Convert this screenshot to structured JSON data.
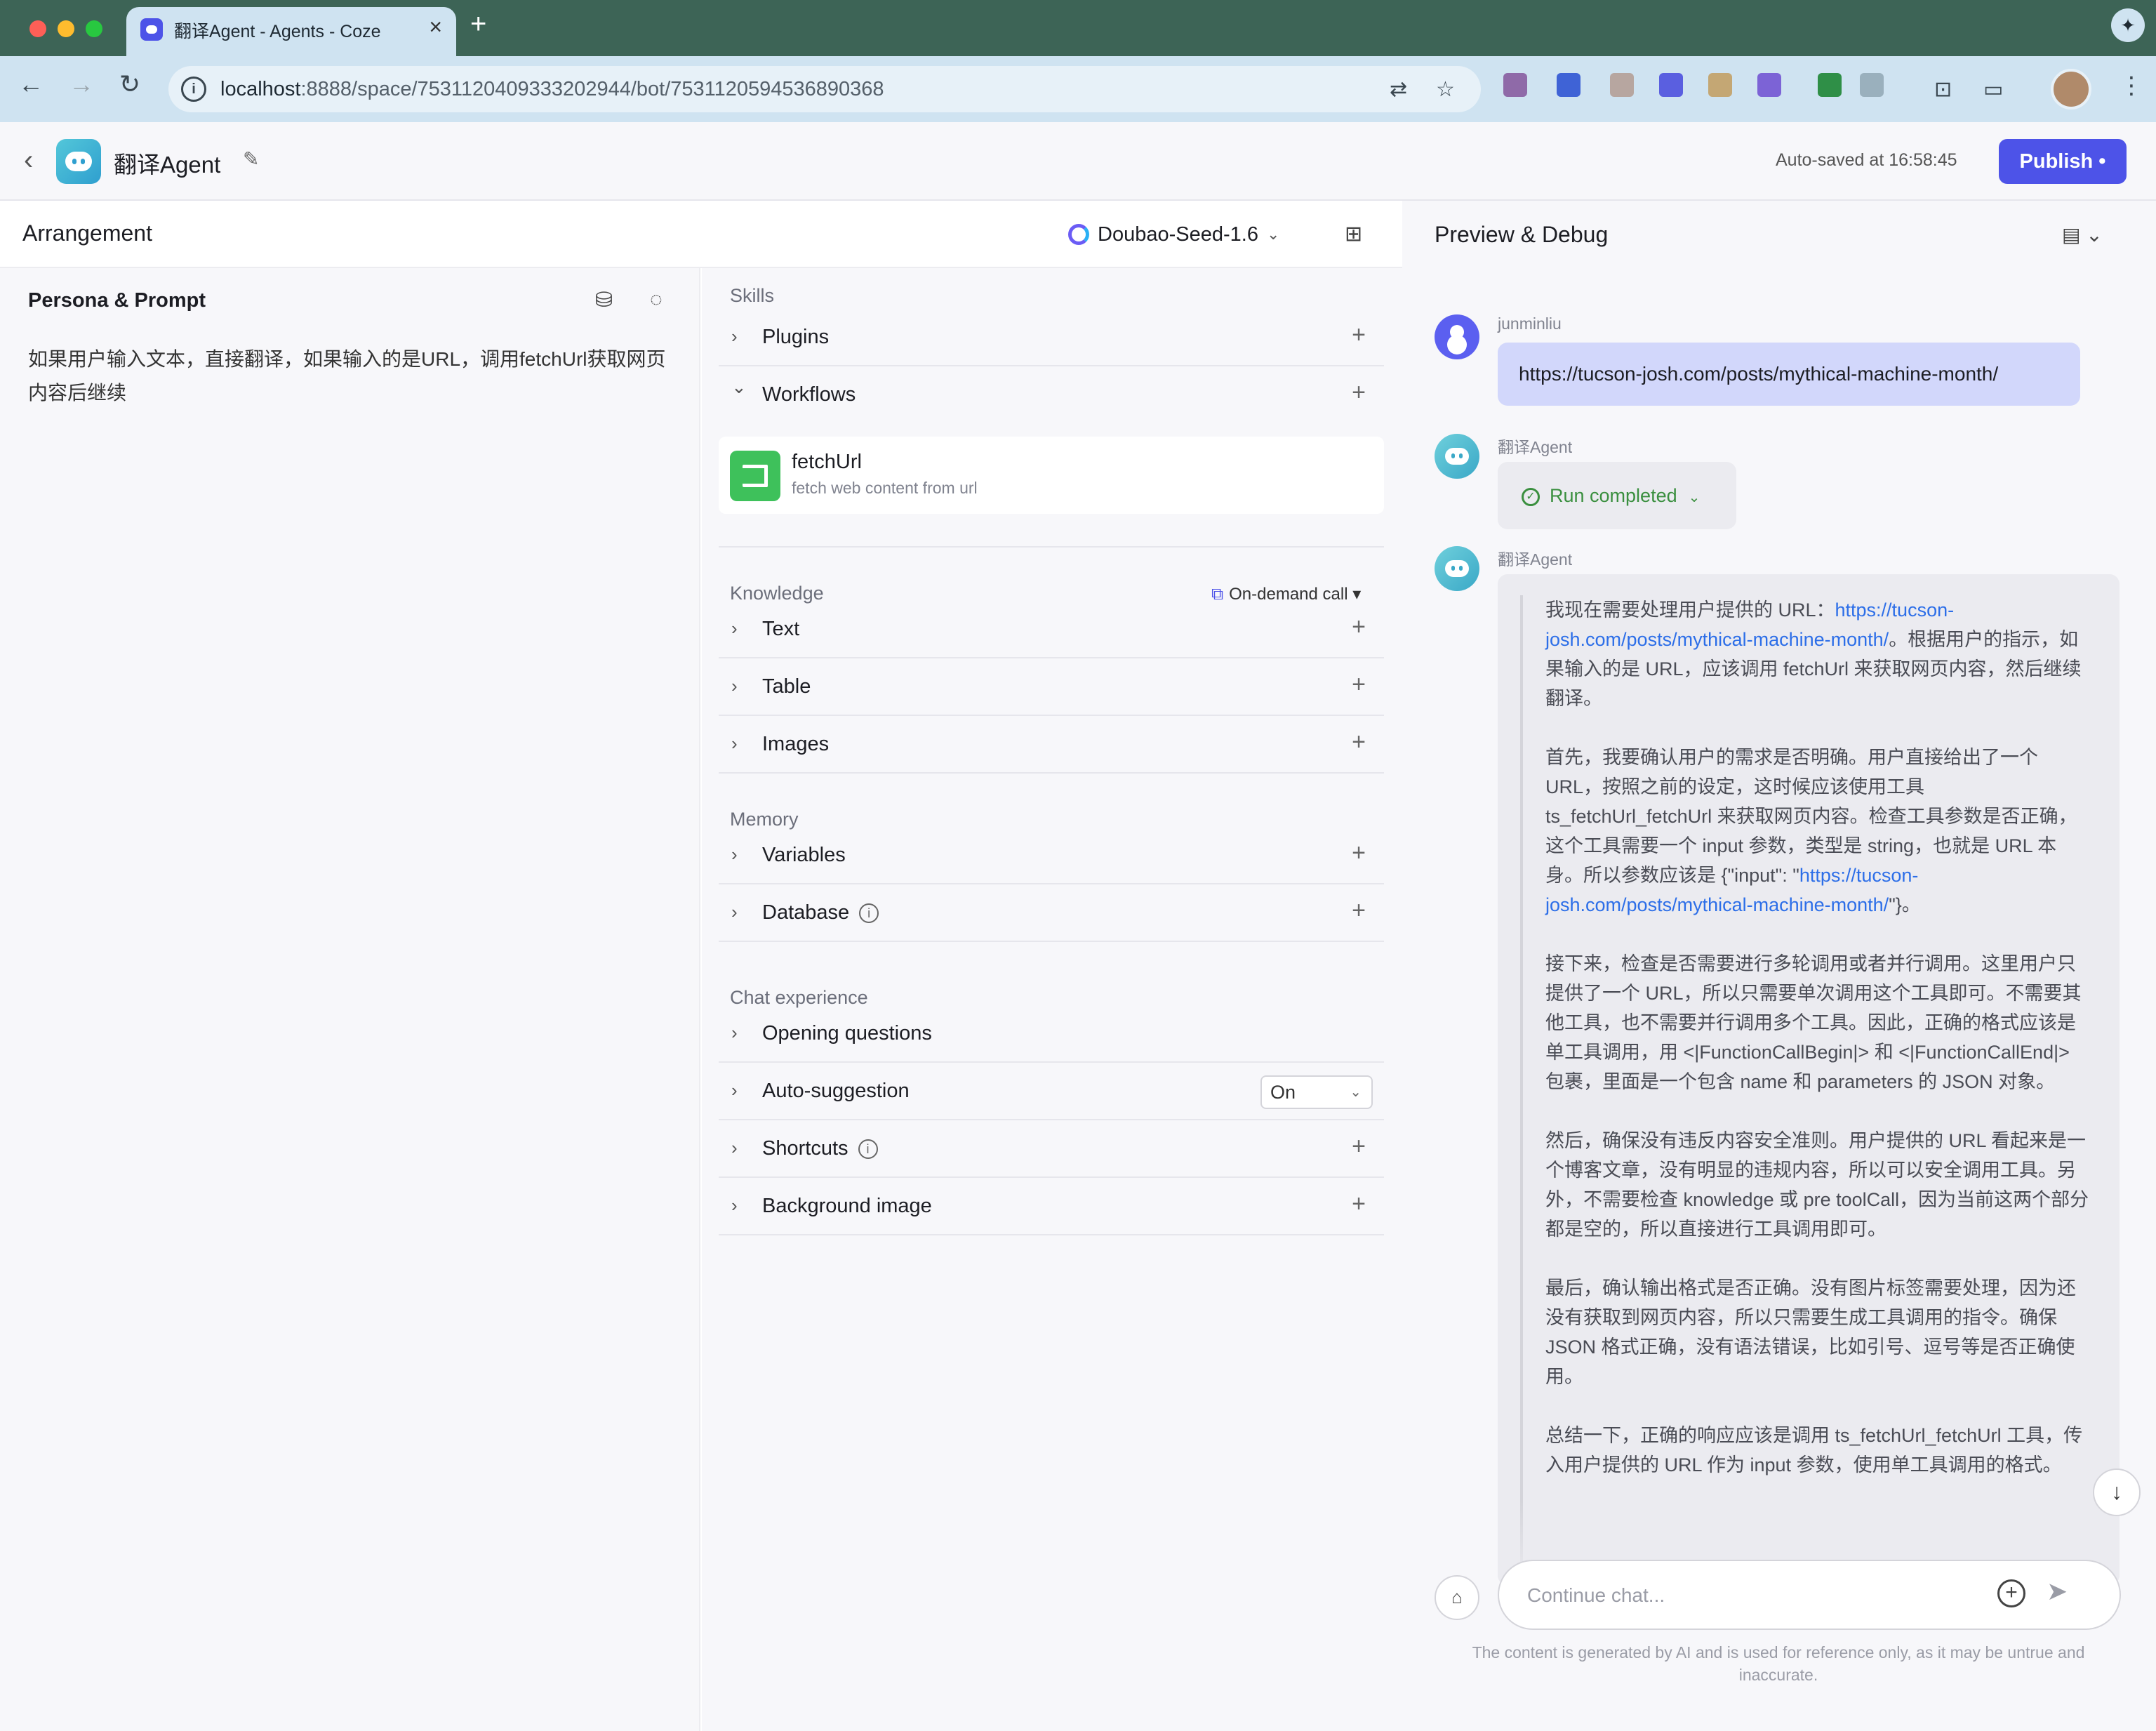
{
  "browser": {
    "tab_title": "翻译Agent - Agents - Coze",
    "new_tab": "+",
    "close": "×",
    "url_host": "localhost",
    "url_rest": ":8888/space/7531120409333202944/bot/7531120594536890368"
  },
  "header": {
    "bot_name": "翻译Agent",
    "autosave": "Auto-saved at 16:58:45",
    "publish_label": "Publish •"
  },
  "arrangement": {
    "title": "Arrangement",
    "model": "Doubao-Seed-1.6"
  },
  "persona": {
    "title": "Persona & Prompt",
    "prompt": "如果用户输入文本，直接翻译，如果输入的是URL，调用fetchUrl获取网页内容后继续"
  },
  "skills": {
    "label": "Skills",
    "plugins": "Plugins",
    "workflows": "Workflows",
    "workflow_items": [
      {
        "name": "fetchUrl",
        "desc": "fetch web content from url"
      }
    ]
  },
  "knowledge": {
    "label": "Knowledge",
    "mode": "On-demand call",
    "items": [
      "Text",
      "Table",
      "Images"
    ]
  },
  "memory": {
    "label": "Memory",
    "items": [
      "Variables",
      "Database"
    ]
  },
  "chat_experience": {
    "label": "Chat experience",
    "opening": "Opening questions",
    "auto_suggestion": "Auto-suggestion",
    "auto_suggestion_value": "On",
    "shortcuts": "Shortcuts",
    "background": "Background image"
  },
  "preview": {
    "title": "Preview & Debug",
    "user_name": "junminliu",
    "user_message": "https://tucson-josh.com/posts/mythical-machine-month/",
    "bot_name": "翻译Agent",
    "run_status": "Run completed",
    "thinking": {
      "p1_a": "我现在需要处理用户提供的 URL：",
      "p1_link": "https://tucson-josh.com/posts/mythical-machine-month/",
      "p1_b": "。根据用户的指示，如果输入的是 URL，应该调用 fetchUrl 来获取网页内容，然后继续翻译。",
      "p2_a": "首先，我要确认用户的需求是否明确。用户直接给出了一个 URL，按照之前的设定，这时候应该使用工具 ts_fetchUrl_fetchUrl 来获取网页内容。检查工具参数是否正确，这个工具需要一个 input 参数，类型是 string，也就是 URL 本身。所以参数应该是 {\"input\": \"",
      "p2_link": "https://tucson-josh.com/posts/mythical-machine-month/",
      "p2_b": "\"}。",
      "p3": "接下来，检查是否需要进行多轮调用或者并行调用。这里用户只提供了一个 URL，所以只需要单次调用这个工具即可。不需要其他工具，也不需要并行调用多个工具。因此，正确的格式应该是单工具调用，用 <|FunctionCallBegin|> 和 <|FunctionCallEnd|> 包裹，里面是一个包含 name 和 parameters 的 JSON 对象。",
      "p4": "然后，确保没有违反内容安全准则。用户提供的 URL 看起来是一个博客文章，没有明显的违规内容，所以可以安全调用工具。另外，不需要检查 knowledge 或 pre toolCall，因为当前这两个部分都是空的，所以直接进行工具调用即可。",
      "p5": "最后，确认输出格式是否正确。没有图片标签需要处理，因为还没有获取到网页内容，所以只需要生成工具调用的指令。确保 JSON 格式正确，没有语法错误，比如引号、逗号等是否正确使用。",
      "p6": "总结一下，正确的响应应该是调用 ts_fetchUrl_fetchUrl 工具，传入用户提供的 URL 作为 input 参数，使用单工具调用的格式。"
    },
    "input_placeholder": "Continue chat...",
    "disclaimer": "The content is generated by AI and is used for reference only, as it may be untrue and inaccurate."
  },
  "icons": {
    "back": "‹",
    "chevron_right": "›",
    "chevron_down": "⌄",
    "plus": "+",
    "info": "i",
    "scroll_down": "↓",
    "send": "➤"
  },
  "colors": {
    "accent": "#4d53e8",
    "success": "#3a8f3f",
    "link": "#2c6ee8",
    "user_bubble": "#d2d7fb"
  }
}
